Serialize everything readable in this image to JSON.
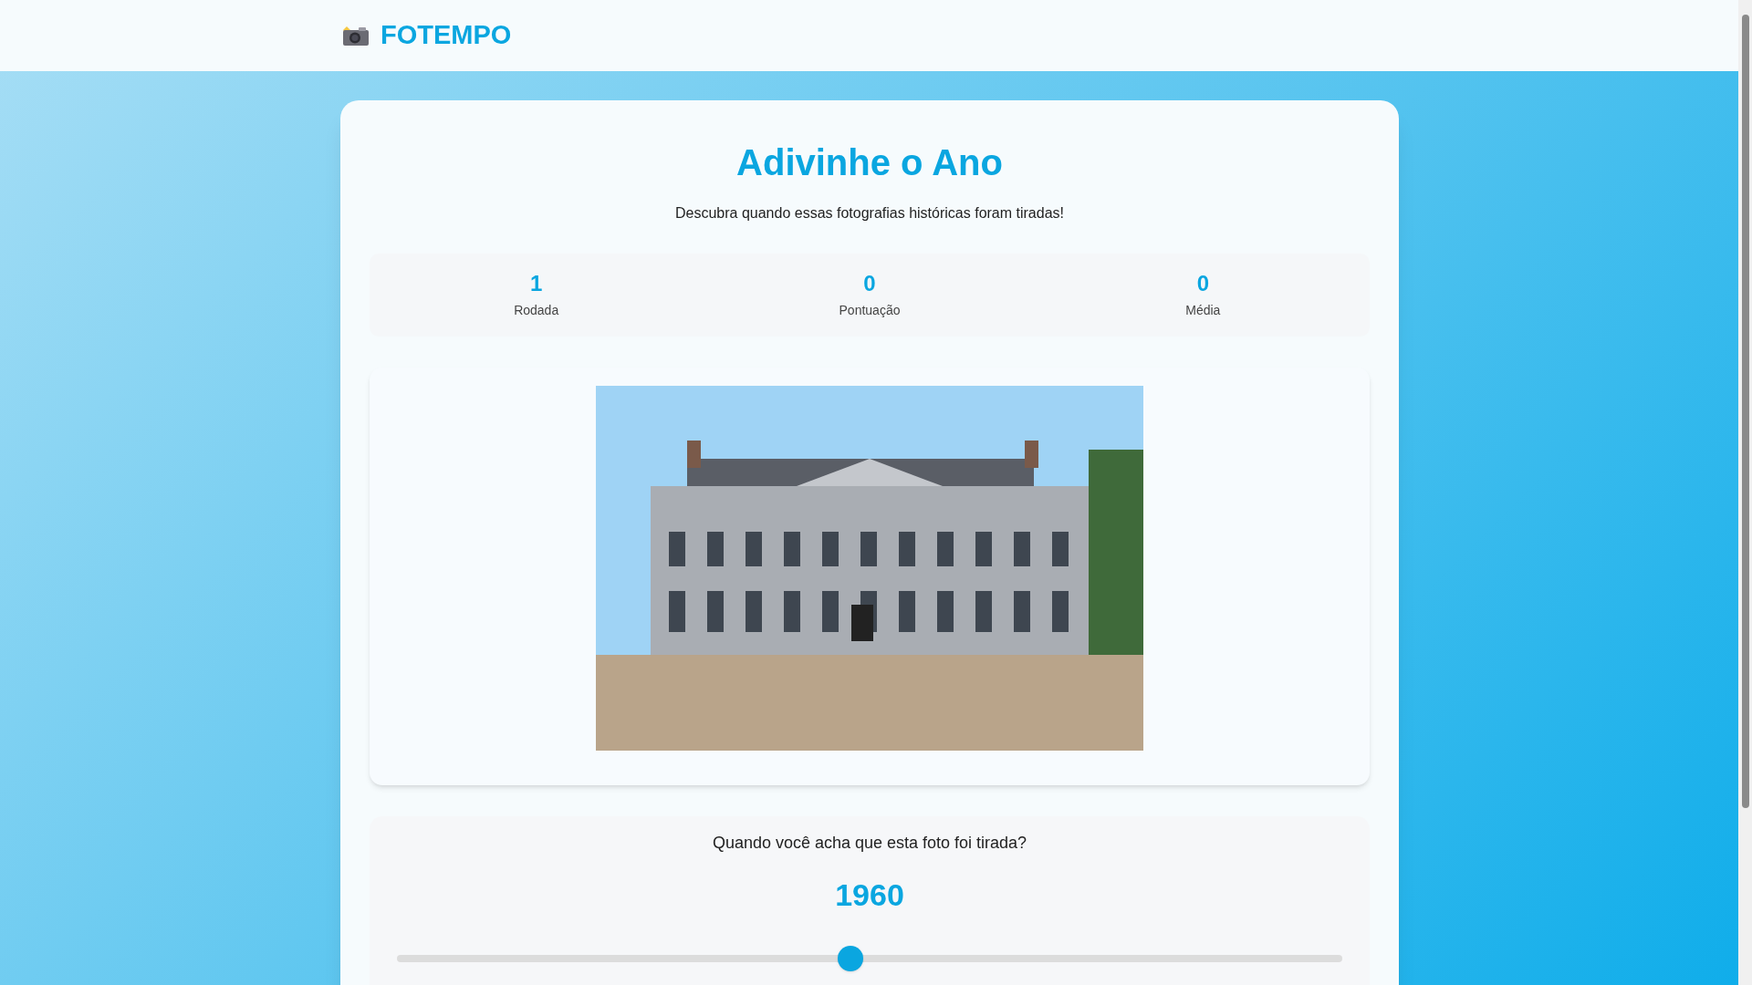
{
  "header": {
    "brand": "FOTEMPO"
  },
  "game": {
    "title": "Adivinhe o Ano",
    "subtitle": "Descubra quando essas fotografias históricas foram tiradas!",
    "stats": [
      {
        "value": "1",
        "label": "Rodada"
      },
      {
        "value": "0",
        "label": "Pontuação"
      },
      {
        "value": "0",
        "label": "Média"
      }
    ],
    "question": "Quando você acha que esta foto foi tirada?",
    "guess": "1960",
    "slider": {
      "level": 0.48
    }
  }
}
